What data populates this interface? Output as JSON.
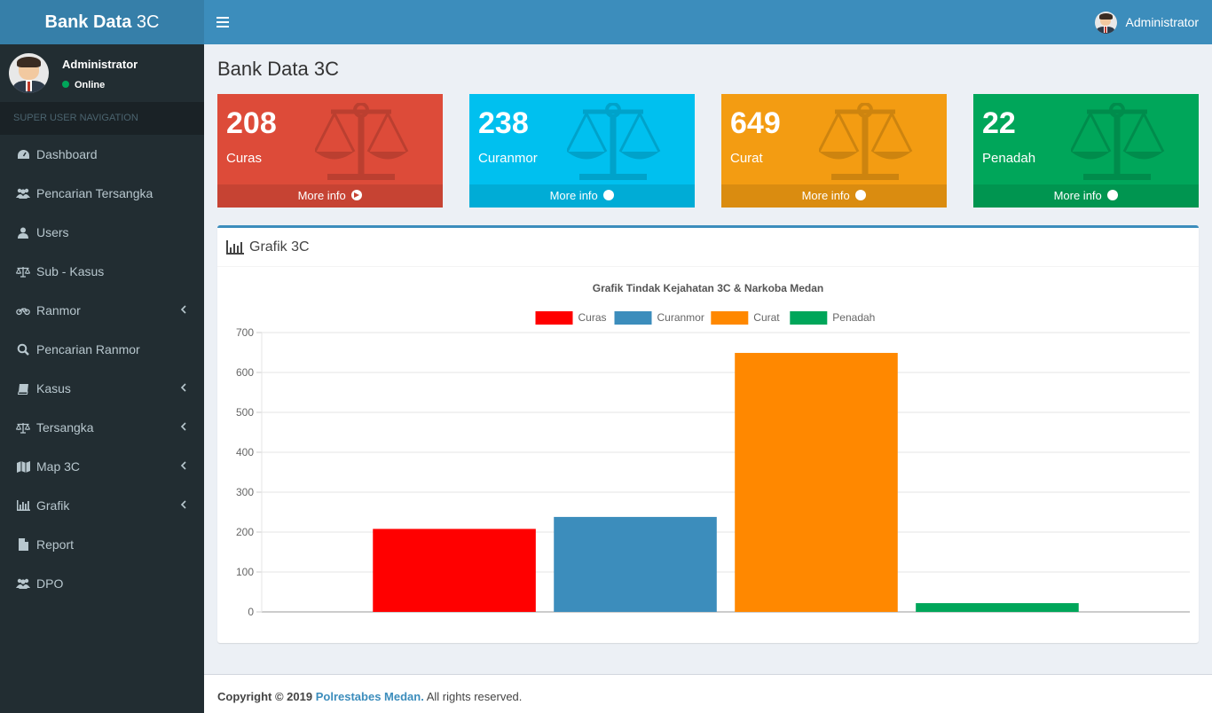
{
  "header": {
    "logo_bold": "Bank Data",
    "logo_light": "3C",
    "user_name": "Administrator"
  },
  "sidebar": {
    "user_name": "Administrator",
    "status": "Online",
    "nav_header": "SUPER USER NAVIGATION",
    "items": [
      {
        "label": "Dashboard",
        "icon": "dashboard-icon"
      },
      {
        "label": "Pencarian Tersangka",
        "icon": "users-icon"
      },
      {
        "label": "Users",
        "icon": "user-icon"
      },
      {
        "label": "Sub - Kasus",
        "icon": "balance-scale-icon"
      },
      {
        "label": "Ranmor",
        "icon": "motorcycle-icon",
        "submenu": true
      },
      {
        "label": "Pencarian Ranmor",
        "icon": "search-icon"
      },
      {
        "label": "Kasus",
        "icon": "book-icon",
        "submenu": true
      },
      {
        "label": "Tersangka",
        "icon": "balance-scale-icon",
        "submenu": true
      },
      {
        "label": "Map 3C",
        "icon": "map-icon",
        "submenu": true
      },
      {
        "label": "Grafik",
        "icon": "bar-chart-icon",
        "submenu": true
      },
      {
        "label": "Report",
        "icon": "file-icon"
      },
      {
        "label": "DPO",
        "icon": "users-icon"
      }
    ]
  },
  "content": {
    "title": "Bank Data 3C",
    "stat_boxes": [
      {
        "value": "208",
        "label": "Curas",
        "footer": "More info",
        "color": "#dd4b39"
      },
      {
        "value": "238",
        "label": "Curanmor",
        "footer": "More info",
        "color": "#00c0ef"
      },
      {
        "value": "649",
        "label": "Curat",
        "footer": "More info",
        "color": "#f39c12"
      },
      {
        "value": "22",
        "label": "Penadah",
        "footer": "More info",
        "color": "#00a65a"
      }
    ],
    "chart_box_title": "Grafik 3C"
  },
  "chart_data": {
    "type": "bar",
    "title": "Grafik Tindak Kejahatan 3C & Narkoba Medan",
    "xlabel": "",
    "ylabel": "",
    "ylim": [
      0,
      700
    ],
    "yticks": [
      0,
      100,
      200,
      300,
      400,
      500,
      600,
      700
    ],
    "grid": true,
    "legend_position": "top-center",
    "series": [
      {
        "name": "Curas",
        "values": [
          208
        ],
        "color": "#ff0000"
      },
      {
        "name": "Curanmor",
        "values": [
          238
        ],
        "color": "#3c8dbc"
      },
      {
        "name": "Curat",
        "values": [
          649
        ],
        "color": "#ff8800"
      },
      {
        "name": "Penadah",
        "values": [
          22
        ],
        "color": "#00a65a"
      }
    ]
  },
  "footer": {
    "copyright": "Copyright © 2019",
    "org": "Polrestabes Medan.",
    "rights": "All rights reserved."
  }
}
